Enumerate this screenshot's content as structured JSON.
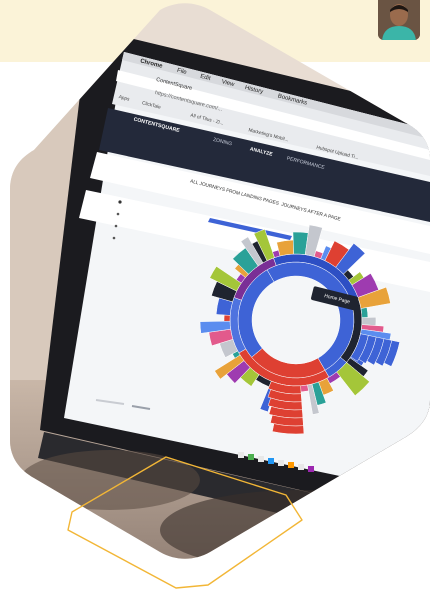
{
  "theme": {
    "band_color": "#fbf3d8",
    "accent_color": "#f2b636",
    "chart_blue": "#3e63d6",
    "chart_red": "#de4032"
  },
  "browser": {
    "menu": [
      "Chrome",
      "File",
      "Edit",
      "View",
      "History",
      "Bookmarks"
    ],
    "tab_title": "ContentSquare",
    "url": "https://contentsquare.com/...",
    "bookmarks": [
      "Apps",
      "ClickTale",
      "All of Tilus - Zl...",
      "Marketing's Mobil...",
      "Hubspot Upload Ti..."
    ]
  },
  "app": {
    "logo": "CONTENTSQUARE",
    "nav": [
      "ZONING",
      "ANALYZE",
      "PERFORMANCE"
    ],
    "active_nav": "ANALYZE",
    "subtabs": [
      "ALL JOURNEYS FROM LANDING PAGES",
      "JOURNEYS AFTER A PAGE"
    ],
    "tooltip": "Home Page"
  },
  "icons": {
    "avatar": "person-avatar",
    "decor": "outline-hexagon-icon"
  }
}
